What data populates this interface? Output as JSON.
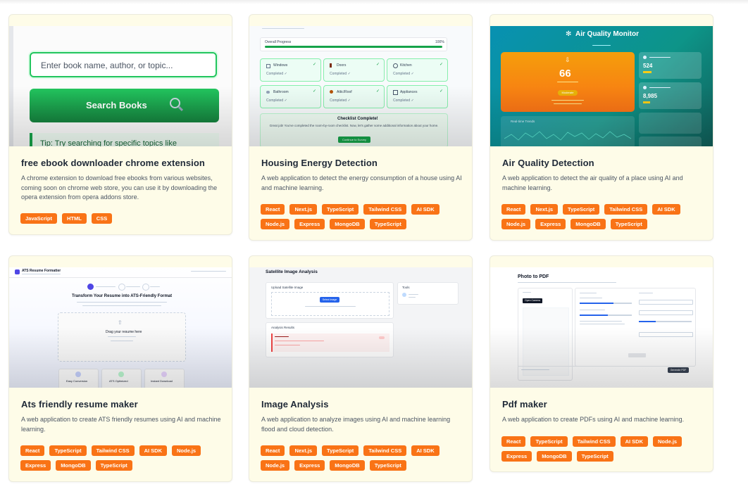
{
  "projects": [
    {
      "title": "free ebook downloader chrome extension",
      "description": "A chrome extension to download free ebooks from various websites, coming soon on chrome web store, you can use it by downloading the opera extension from opera addons store.",
      "tags": [
        "JavaScript",
        "HTML",
        "CSS"
      ],
      "preview": {
        "input_placeholder": "Enter book name, author, or topic...",
        "button_label": "Search Books",
        "tip": "Tip: Try searching for specific topics like"
      }
    },
    {
      "title": "Housing Energy Detection",
      "description": "A web application to detect the energy consumption of a house using AI and machine learning.",
      "tags": [
        "React",
        "Next.js",
        "TypeScript",
        "Tailwind CSS",
        "AI SDK",
        "Node.js",
        "Express",
        "MongoDB",
        "TypeScript"
      ],
      "preview": {
        "progress_label": "Overall Progress",
        "progress_value": "100%",
        "rooms": [
          "Windows",
          "Doors",
          "Kitchen",
          "Bathroom",
          "Attic/Roof",
          "Appliances"
        ],
        "room_status": "Completed ✓",
        "complete_title": "Checklist Complete!",
        "complete_text": "Great job! You've completed the room-by-room checklist. Now, let's gather some additional information about your home.",
        "continue_label": "Continue to Survey"
      }
    },
    {
      "title": "Air Quality Detection",
      "description": "A web application to detect the air quality of a place using AI and machine learning.",
      "tags": [
        "React",
        "Next.js",
        "TypeScript",
        "Tailwind CSS",
        "AI SDK",
        "Node.js",
        "Express",
        "MongoDB",
        "TypeScript"
      ],
      "preview": {
        "app_title": "Air Quality Monitor",
        "aqi": "66",
        "aqi_status": "Moderate",
        "stat1": "524",
        "stat2": "8,985",
        "trend_label": "Real-time Trends"
      }
    },
    {
      "title": "Ats friendly resume maker",
      "description": "A web application to create ATS friendly resumes using AI and machine learning.",
      "tags": [
        "React",
        "TypeScript",
        "Tailwind CSS",
        "AI SDK",
        "Node.js",
        "Express",
        "MongoDB",
        "TypeScript"
      ],
      "preview": {
        "app_title": "ATS Resume Formatter",
        "headline": "Transform Your Resume into ATS-Friendly Format",
        "upload_text": "Drag your resume here",
        "features": [
          "Easy Conversion",
          "ATS Optimized",
          "Instant Download"
        ]
      }
    },
    {
      "title": "Image Analysis",
      "description": "A web application to analyze images using AI and machine learning flood and cloud detection.",
      "tags": [
        "React",
        "Next.js",
        "TypeScript",
        "Tailwind CSS",
        "AI SDK",
        "Node.js",
        "Express",
        "MongoDB",
        "TypeScript"
      ],
      "preview": {
        "app_title": "Satellite Image Analysis",
        "upload_label": "Upload Satellite Image",
        "select_label": "Select Image",
        "tools_label": "Tools",
        "results_label": "Analysis Results"
      }
    },
    {
      "title": "Pdf maker",
      "description": "A web application to create PDFs using AI and machine learning.",
      "tags": [
        "React",
        "TypeScript",
        "Tailwind CSS",
        "AI SDK",
        "Node.js",
        "Express",
        "MongoDB",
        "TypeScript"
      ],
      "preview": {
        "app_title": "Photo to PDF",
        "capture_label": "Open Camera",
        "generate_label": "Generate PDF"
      }
    }
  ],
  "colors": {
    "tag": "#f97316",
    "card": "#fefce8",
    "green": "#16a34a"
  }
}
